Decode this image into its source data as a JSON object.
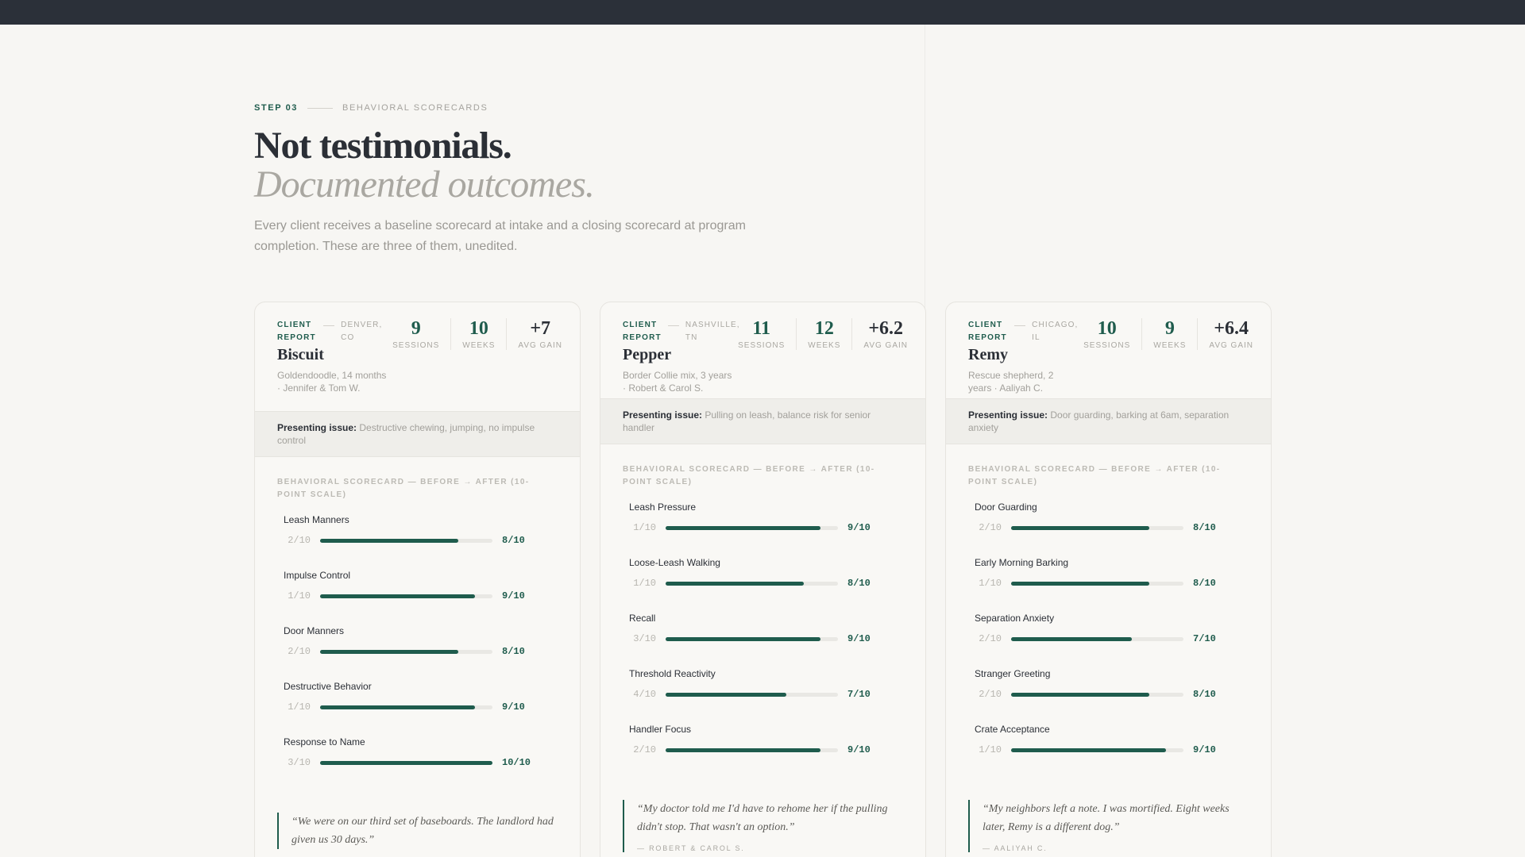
{
  "eyebrow": {
    "step": "STEP 03",
    "section": "BEHAVIORAL SCORECARDS"
  },
  "headline": {
    "line1": "Not testimonials.",
    "line2": "Documented outcomes."
  },
  "lead": "Every client receives a baseline scorecard at intake and a closing scorecard at program completion. These are three of them, unedited.",
  "cards": [
    {
      "label": "CLIENT REPORT",
      "city": "DENVER, CO",
      "name": "Biscuit",
      "breed": "Goldendoodle, 14 months · Jennifer & Tom W.",
      "stats": [
        {
          "num": "9",
          "lbl": "SESSIONS"
        },
        {
          "num": "10",
          "lbl": "WEEKS"
        },
        {
          "num": "+7",
          "lbl": "AVG GAIN"
        }
      ],
      "issue_label": "Presenting issue:",
      "issue_text": "Destructive chewing, jumping, no impulse control",
      "scorecard_title": "BEHAVIORAL SCORECARD — BEFORE → AFTER (10-POINT SCALE)",
      "metrics": [
        {
          "name": "Leash Manners",
          "before": "2/10",
          "after": "8/10",
          "after_value": 8
        },
        {
          "name": "Impulse Control",
          "before": "1/10",
          "after": "9/10",
          "after_value": 9
        },
        {
          "name": "Door Manners",
          "before": "2/10",
          "after": "8/10",
          "after_value": 8
        },
        {
          "name": "Destructive Behavior",
          "before": "1/10",
          "after": "9/10",
          "after_value": 9
        },
        {
          "name": "Response to Name",
          "before": "3/10",
          "after": "10/10",
          "after_value": 10
        }
      ],
      "quote": "“We were on our third set of baseboards. The landlord had given us 30 days.”",
      "quote_by": ""
    },
    {
      "label": "CLIENT REPORT",
      "city": "NASHVILLE, TN",
      "name": "Pepper",
      "breed": "Border Collie mix, 3 years · Robert & Carol S.",
      "stats": [
        {
          "num": "11",
          "lbl": "SESSIONS"
        },
        {
          "num": "12",
          "lbl": "WEEKS"
        },
        {
          "num": "+6.2",
          "lbl": "AVG GAIN"
        }
      ],
      "issue_label": "Presenting issue:",
      "issue_text": "Pulling on leash, balance risk for senior handler",
      "scorecard_title": "BEHAVIORAL SCORECARD — BEFORE → AFTER (10-POINT SCALE)",
      "metrics": [
        {
          "name": "Leash Pressure",
          "before": "1/10",
          "after": "9/10",
          "after_value": 9
        },
        {
          "name": "Loose-Leash Walking",
          "before": "1/10",
          "after": "8/10",
          "after_value": 8
        },
        {
          "name": "Recall",
          "before": "3/10",
          "after": "9/10",
          "after_value": 9
        },
        {
          "name": "Threshold Reactivity",
          "before": "4/10",
          "after": "7/10",
          "after_value": 7
        },
        {
          "name": "Handler Focus",
          "before": "2/10",
          "after": "9/10",
          "after_value": 9
        }
      ],
      "quote": "“My doctor told me I'd have to rehome her if the pulling didn't stop. That wasn't an option.”",
      "quote_by": "— ROBERT & CAROL S."
    },
    {
      "label": "CLIENT REPORT",
      "city": "CHICAGO, IL",
      "name": "Remy",
      "breed": "Rescue shepherd, 2 years · Aaliyah C.",
      "stats": [
        {
          "num": "10",
          "lbl": "SESSIONS"
        },
        {
          "num": "9",
          "lbl": "WEEKS"
        },
        {
          "num": "+6.4",
          "lbl": "AVG GAIN"
        }
      ],
      "issue_label": "Presenting issue:",
      "issue_text": "Door guarding, barking at 6am, separation anxiety",
      "scorecard_title": "BEHAVIORAL SCORECARD — BEFORE → AFTER (10-POINT SCALE)",
      "metrics": [
        {
          "name": "Door Guarding",
          "before": "2/10",
          "after": "8/10",
          "after_value": 8
        },
        {
          "name": "Early Morning Barking",
          "before": "1/10",
          "after": "8/10",
          "after_value": 8
        },
        {
          "name": "Separation Anxiety",
          "before": "2/10",
          "after": "7/10",
          "after_value": 7
        },
        {
          "name": "Stranger Greeting",
          "before": "2/10",
          "after": "8/10",
          "after_value": 8
        },
        {
          "name": "Crate Acceptance",
          "before": "1/10",
          "after": "9/10",
          "after_value": 9
        }
      ],
      "quote": "“My neighbors left a note. I was mortified. Eight weeks later, Remy is a different dog.”",
      "quote_by": "— AALIYAH C."
    }
  ]
}
